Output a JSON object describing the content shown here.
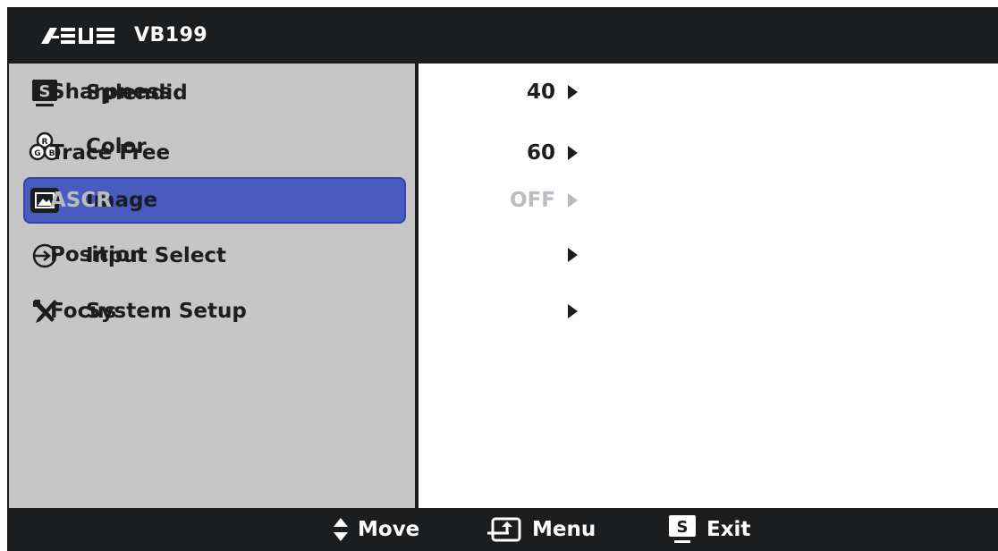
{
  "header": {
    "brand": "ASUS",
    "model": "VB199"
  },
  "colors": {
    "title_bar": "#1b1d1f",
    "sidebar": "#c6c6c7",
    "selected": "#4a5bbf",
    "disabled": "#b9bcc0"
  },
  "sidebar": {
    "items": [
      {
        "label": "Splendid",
        "icon": "splendid-s-icon"
      },
      {
        "label": "Color",
        "icon": "rgb-circles-icon"
      },
      {
        "label": "Image",
        "icon": "image-frame-icon",
        "selected": true
      },
      {
        "label": "Input Select",
        "icon": "input-arrow-icon"
      },
      {
        "label": "System Setup",
        "icon": "tools-icon"
      }
    ]
  },
  "settings": {
    "items": [
      {
        "label": "Sharpness",
        "value": "40",
        "enabled": true
      },
      {
        "label": "Trace Free",
        "value": "60",
        "enabled": true
      },
      {
        "label": "ASCR",
        "value": "OFF",
        "enabled": false
      },
      {
        "label": "Position",
        "value": "",
        "enabled": true
      },
      {
        "label": "Focus",
        "value": "",
        "enabled": true
      }
    ]
  },
  "footer": {
    "move_label": "Move",
    "menu_label": "Menu",
    "exit_label": "Exit",
    "exit_key": "S",
    "splendid_key": "S"
  }
}
